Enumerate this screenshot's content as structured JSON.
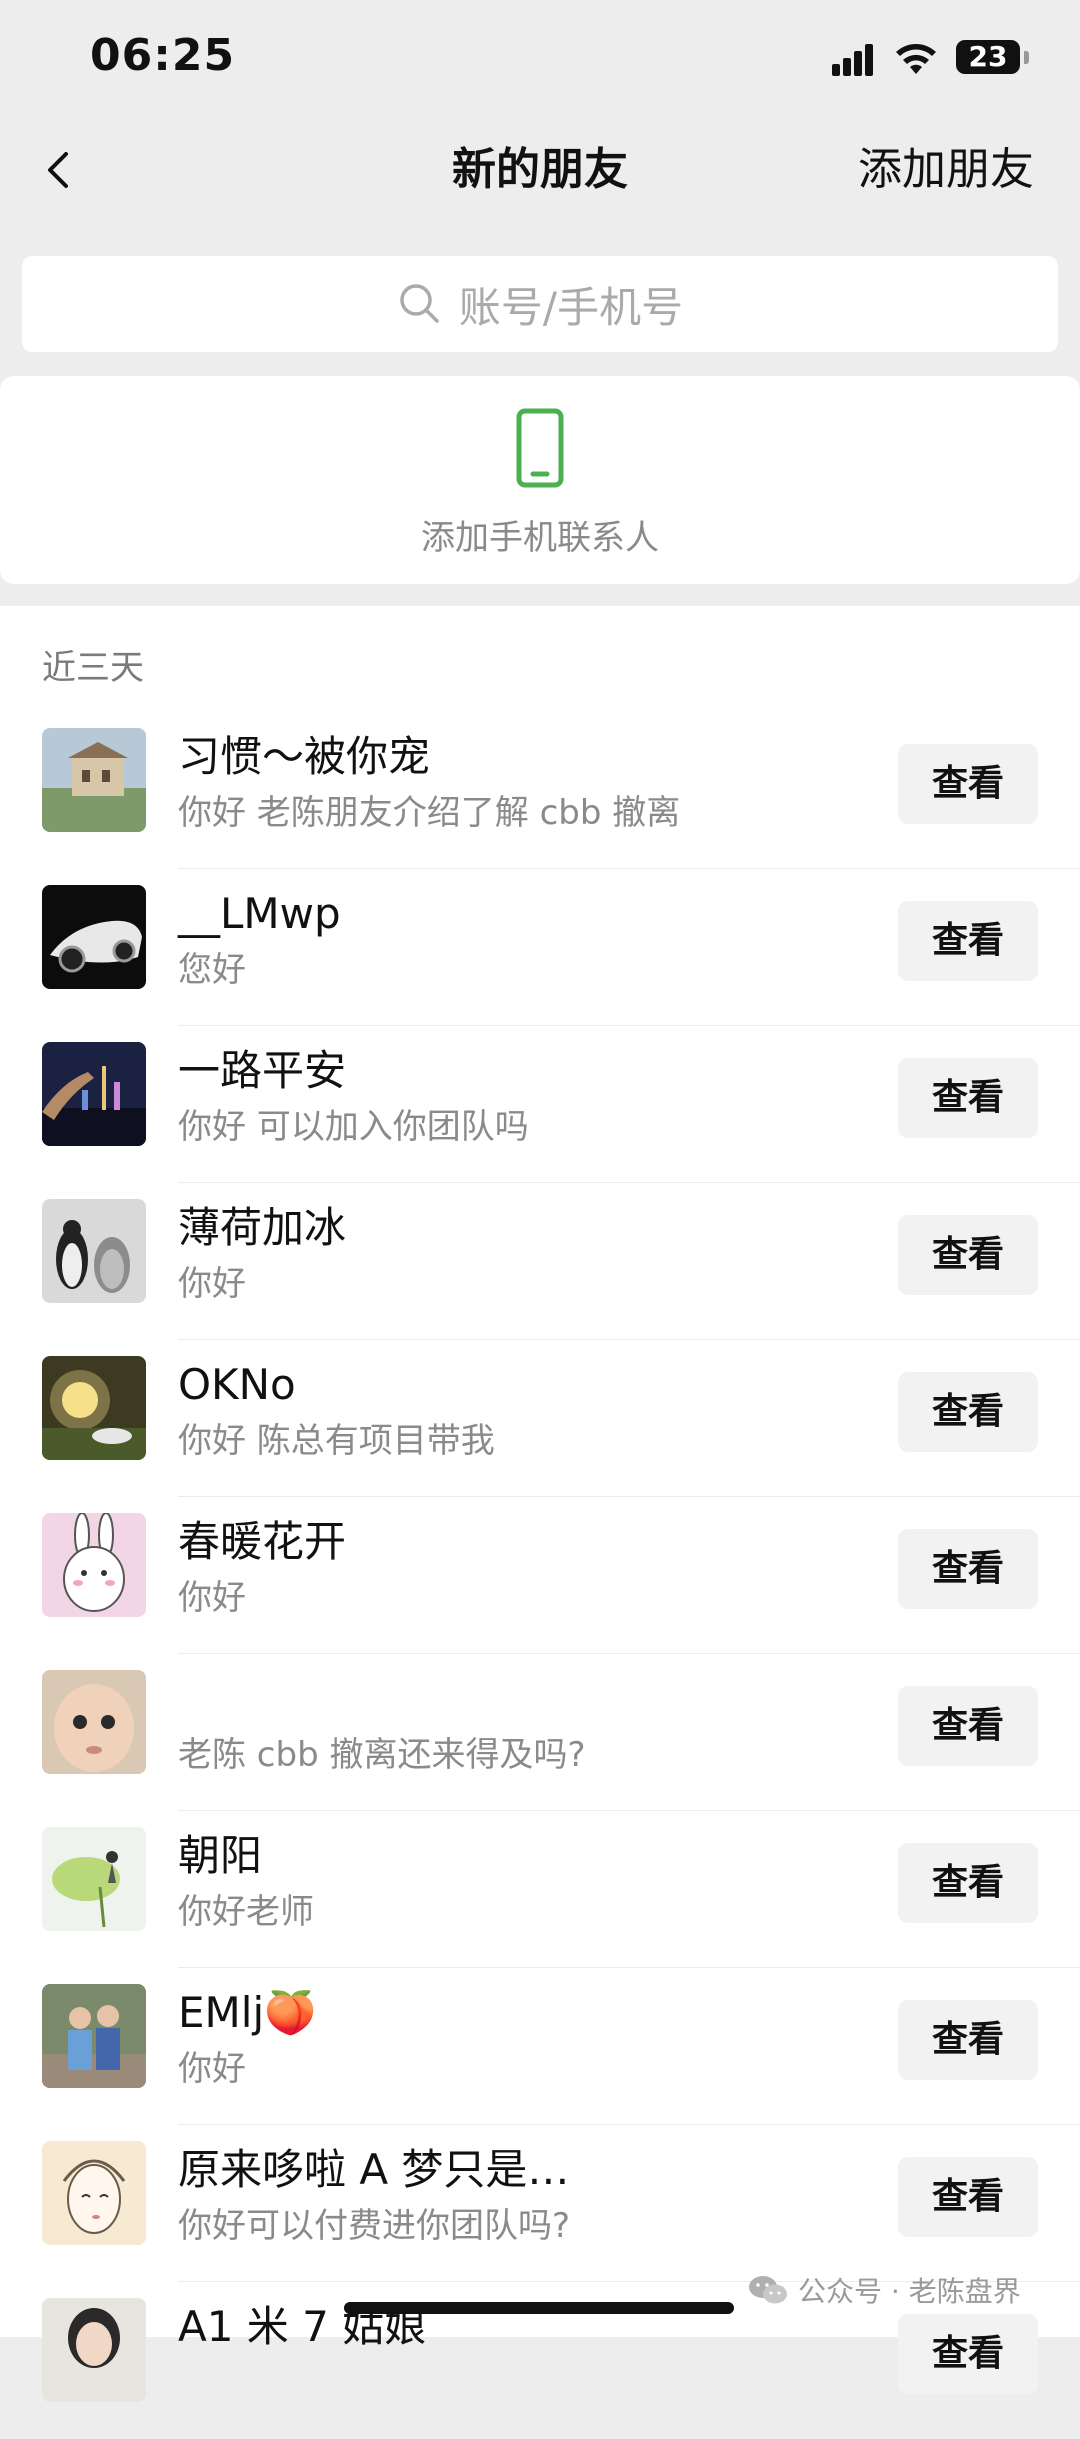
{
  "status": {
    "time": "06:25",
    "battery": "23"
  },
  "nav": {
    "title": "新的朋友",
    "action": "添加朋友"
  },
  "search": {
    "placeholder": "账号/手机号"
  },
  "phone_card": {
    "label": "添加手机联系人"
  },
  "section": {
    "header": "近三天"
  },
  "requests": [
    {
      "name": "习惯～被你宠",
      "message": "你好 老陈朋友介绍了解 cbb 撤离",
      "button": "查看"
    },
    {
      "name": "__LMwp",
      "message": "您好",
      "button": "查看"
    },
    {
      "name": "一路平安",
      "message": "你好 可以加入你团队吗",
      "button": "查看"
    },
    {
      "name": "薄荷加冰",
      "message": "你好",
      "button": "查看"
    },
    {
      "name": "OKNo",
      "message": "你好 陈总有项目带我",
      "button": "查看"
    },
    {
      "name": "春暖花开",
      "message": "你好",
      "button": "查看"
    },
    {
      "name": "",
      "message": "老陈 cbb 撤离还来得及吗?",
      "button": "查看"
    },
    {
      "name": "朝阳",
      "message": "你好老师",
      "button": "查看"
    },
    {
      "name": "EMlj🍑",
      "message": "你好",
      "button": "查看"
    },
    {
      "name": "原来哆啦 A 梦只是…",
      "message": "你好可以付费进你团队吗?",
      "button": "查看"
    },
    {
      "name": "A1 米 7 姑娘",
      "message": "",
      "button": "查看"
    }
  ],
  "watermark": {
    "text": "公众号 · 老陈盘界"
  },
  "colors": {
    "accent": "#4caf50",
    "background": "#ededed",
    "button_bg": "#f2f2f2"
  }
}
